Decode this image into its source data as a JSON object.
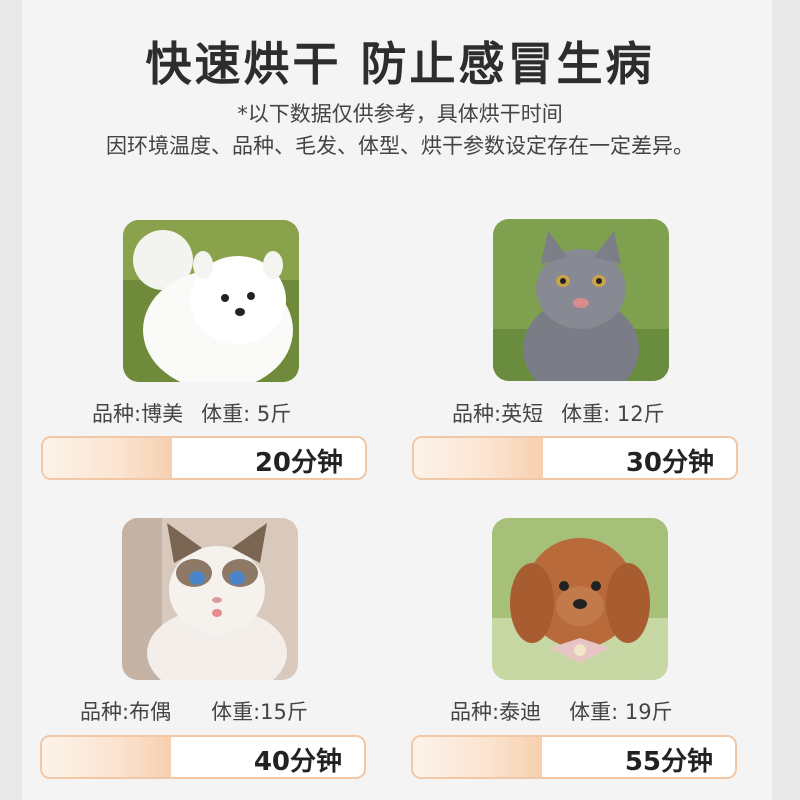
{
  "header": {
    "title": "快速烘干 防止感冒生病",
    "note_line1": "*以下数据仅供参考，具体烘干时间",
    "note_line2": "因环境温度、品种、毛发、体型、烘干参数设定存在一定差异。"
  },
  "pets": [
    {
      "breed": "品种:博美",
      "weight": "体重: 5斤",
      "time": "20分钟",
      "progress": 0.4,
      "photo": "white-pomeranian"
    },
    {
      "breed": "品种:英短",
      "weight": "体重: 12斤",
      "time": "30分钟",
      "progress": 0.4,
      "photo": "grey-british-shorthair"
    },
    {
      "breed": "品种:布偶",
      "weight": "体重:15斤",
      "time": "40分钟",
      "progress": 0.4,
      "photo": "ragdoll-cat"
    },
    {
      "breed": "品种:泰迪",
      "weight": "体重: 19斤",
      "time": "55分钟",
      "progress": 0.4,
      "photo": "brown-teddy-poodle"
    }
  ],
  "colors": {
    "bar_border": "#f1c7a6",
    "bar_fill": "#f7cfae",
    "background": "#f4f4f4"
  }
}
